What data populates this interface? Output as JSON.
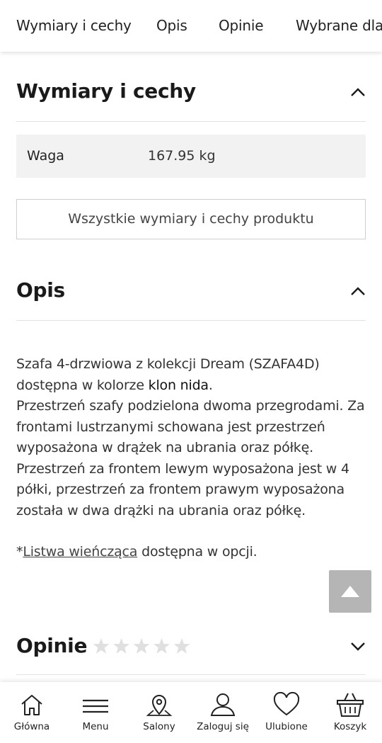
{
  "tabs": [
    "Wymiary i cechy",
    "Opis",
    "Opinie",
    "Wybrane dla"
  ],
  "dimensions": {
    "title": "Wymiary i cechy",
    "specs": [
      {
        "label": "Waga",
        "value": "167.95 kg"
      }
    ],
    "all_button": "Wszystkie wymiary i cechy produktu"
  },
  "description": {
    "title": "Opis",
    "line1_pre": "Szafa 4-drzwiowa z kolekcji Dream (SZAFA4D) dostępna w kolorze ",
    "color_name": "klon nida",
    "line1_post": ".",
    "body": "Przestrzeń szafy podzielona dwoma przegrodami. Za frontami lustrzanymi schowana jest przestrzeń wyposażona w drążek na ubrania oraz półkę. Przestrzeń za frontem lewym wyposażona jest w 4 półki, przestrzeń za frontem prawym wyposażona została w dwa drążki na ubrania oraz półkę.",
    "note_prefix": "*",
    "note_link": "Listwa wieńcząca",
    "note_suffix": " dostępna w opcji."
  },
  "reviews": {
    "title": "Opinie",
    "rating": 0,
    "max_rating": 5
  },
  "bottom_nav": [
    {
      "label": "Główna",
      "icon": "home-icon"
    },
    {
      "label": "Menu",
      "icon": "menu-icon"
    },
    {
      "label": "Salony",
      "icon": "map-pin-icon"
    },
    {
      "label": "Zaloguj się",
      "icon": "user-icon"
    },
    {
      "label": "Ulubione",
      "icon": "heart-icon"
    },
    {
      "label": "Koszyk",
      "icon": "basket-icon"
    }
  ],
  "colors": {
    "accent": "#1a1a1a",
    "scroll_button": "#b5b5b5",
    "star_empty": "#e0e0e0"
  }
}
